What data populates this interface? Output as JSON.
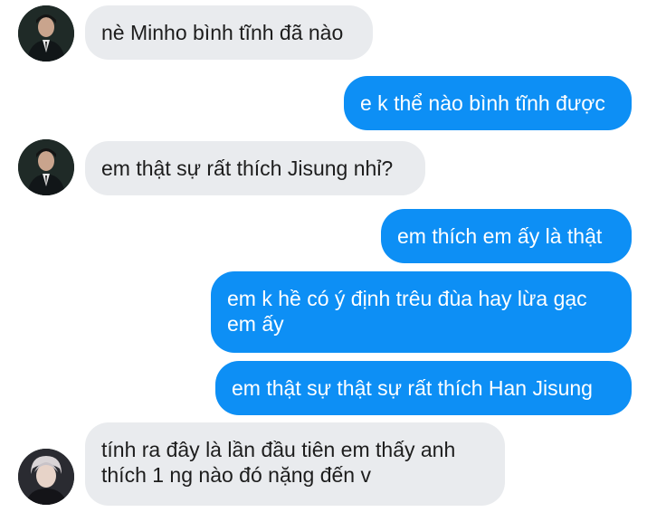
{
  "colors": {
    "incoming_bubble": "#e9ebee",
    "outgoing_bubble": "#0d8ff5",
    "incoming_text": "#1d1d1d",
    "outgoing_text": "#ffffff"
  },
  "messages": [
    {
      "direction": "incoming",
      "lines": [
        "nè Minho bình tĩnh đã nào"
      ],
      "avatar": "avatar-suit"
    },
    {
      "direction": "outgoing",
      "lines": [
        "e k thể nào bình tĩnh được"
      ]
    },
    {
      "direction": "incoming",
      "lines": [
        "em thật sự rất thích Jisung nhỉ?"
      ],
      "avatar": "avatar-suit"
    },
    {
      "direction": "outgoing",
      "lines": [
        "em thích em ấy là thật"
      ]
    },
    {
      "direction": "outgoing",
      "lines": [
        "em k hề có ý định trêu đùa hay lừa gạc",
        "em ấy"
      ]
    },
    {
      "direction": "outgoing",
      "lines": [
        "em thật sự thật sự rất thích Han Jisung"
      ]
    },
    {
      "direction": "incoming",
      "lines": [
        "tính ra đây là lần đầu tiên em thấy anh",
        "thích 1 ng nào đó nặng đến v"
      ],
      "avatar": "avatar-portrait"
    }
  ]
}
